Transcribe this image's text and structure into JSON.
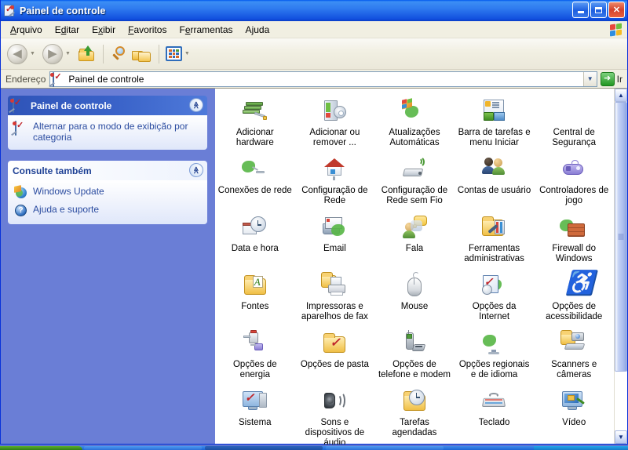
{
  "window": {
    "title": "Painel de controle",
    "title_icon": "control-panel-icon",
    "buttons": {
      "minimize": "_",
      "maximize": "❐",
      "close": "✕"
    }
  },
  "menubar": {
    "items": [
      {
        "label": "Arquivo",
        "accel": "A"
      },
      {
        "label": "Editar",
        "accel": "d"
      },
      {
        "label": "Exibir",
        "accel": "x"
      },
      {
        "label": "Favoritos",
        "accel": "F"
      },
      {
        "label": "Ferramentas",
        "accel": "e"
      },
      {
        "label": "Ajuda",
        "accel": "j"
      }
    ],
    "logo": "windows-flag-icon"
  },
  "toolbar": {
    "back": {
      "name": "back-button",
      "glyph": "◀",
      "enabled": false
    },
    "forward": {
      "name": "forward-button",
      "glyph": "▶",
      "enabled": false
    },
    "up": {
      "name": "up-folder-button"
    },
    "search": {
      "name": "search-button"
    },
    "folders": {
      "name": "folders-button"
    },
    "views": {
      "name": "views-button"
    },
    "caret": "▼"
  },
  "address": {
    "label": "Endereço",
    "value": "Painel de controle",
    "icon": "control-panel-icon",
    "dropdown_glyph": "▼",
    "go_label": "Ir",
    "go_glyph": "➜"
  },
  "sidebar": {
    "panels": [
      {
        "title": "Painel de controle",
        "style": "blue",
        "icon": "control-panel-icon",
        "collapse_glyph": "≪",
        "links": [
          {
            "label": "Alternar para o modo de exibição por categoria",
            "icon": "control-panel-icon"
          }
        ]
      },
      {
        "title": "Consulte também",
        "style": "white",
        "collapse_glyph": "≪",
        "links": [
          {
            "label": "Windows Update",
            "icon": "windows-update-icon"
          },
          {
            "label": "Ajuda e suporte",
            "icon": "help-question-icon"
          }
        ]
      }
    ]
  },
  "items": [
    {
      "label": "Adicionar hardware",
      "icon": "add-hardware-icon"
    },
    {
      "label": "Adicionar ou remover ...",
      "icon": "add-remove-programs-icon"
    },
    {
      "label": "Atualizações Automáticas",
      "icon": "automatic-updates-icon"
    },
    {
      "label": "Barra de tarefas e menu Iniciar",
      "icon": "taskbar-start-menu-icon"
    },
    {
      "label": "Central de Segurança",
      "icon": "security-center-icon"
    },
    {
      "label": "Conexões de rede",
      "icon": "network-connections-icon"
    },
    {
      "label": "Configuração de Rede",
      "icon": "network-setup-icon"
    },
    {
      "label": "Configuração de Rede sem Fio",
      "icon": "wireless-network-setup-icon"
    },
    {
      "label": "Contas de usuário",
      "icon": "user-accounts-icon"
    },
    {
      "label": "Controladores de jogo",
      "icon": "game-controllers-icon"
    },
    {
      "label": "Data e hora",
      "icon": "date-time-icon"
    },
    {
      "label": "Email",
      "icon": "email-icon"
    },
    {
      "label": "Fala",
      "icon": "speech-icon"
    },
    {
      "label": "Ferramentas administrativas",
      "icon": "administrative-tools-icon"
    },
    {
      "label": "Firewall do Windows",
      "icon": "windows-firewall-icon"
    },
    {
      "label": "Fontes",
      "icon": "fonts-icon"
    },
    {
      "label": "Impressoras e aparelhos de fax",
      "icon": "printers-faxes-icon"
    },
    {
      "label": "Mouse",
      "icon": "mouse-icon"
    },
    {
      "label": "Opções da Internet",
      "icon": "internet-options-icon"
    },
    {
      "label": "Opções de acessibilidade",
      "icon": "accessibility-options-icon"
    },
    {
      "label": "Opções de energia",
      "icon": "power-options-icon"
    },
    {
      "label": "Opções de pasta",
      "icon": "folder-options-icon"
    },
    {
      "label": "Opções de telefone e modem",
      "icon": "phone-modem-options-icon"
    },
    {
      "label": "Opções regionais e de idioma",
      "icon": "regional-language-options-icon"
    },
    {
      "label": "Scanners e câmeras",
      "icon": "scanners-cameras-icon"
    },
    {
      "label": "Sistema",
      "icon": "system-icon"
    },
    {
      "label": "Sons e dispositivos de áudio",
      "icon": "sounds-audio-devices-icon"
    },
    {
      "label": "Tarefas agendadas",
      "icon": "scheduled-tasks-icon"
    },
    {
      "label": "Teclado",
      "icon": "keyboard-icon"
    },
    {
      "label": "Vídeo",
      "icon": "display-icon"
    }
  ],
  "scrollbar": {
    "up_glyph": "▲",
    "down_glyph": "▼",
    "thumb_position_percent": 0,
    "thumb_size_percent": 82
  },
  "colors": {
    "titlebar_blue": "#0a3cc4",
    "sidebar_blue": "#6a7ed6",
    "panel_header_blue": "#2f54b8",
    "link_blue": "#2b4ca0",
    "close_red": "#d3422c",
    "taskbar_blue": "#1b64d4",
    "start_green": "#2f7d17"
  }
}
